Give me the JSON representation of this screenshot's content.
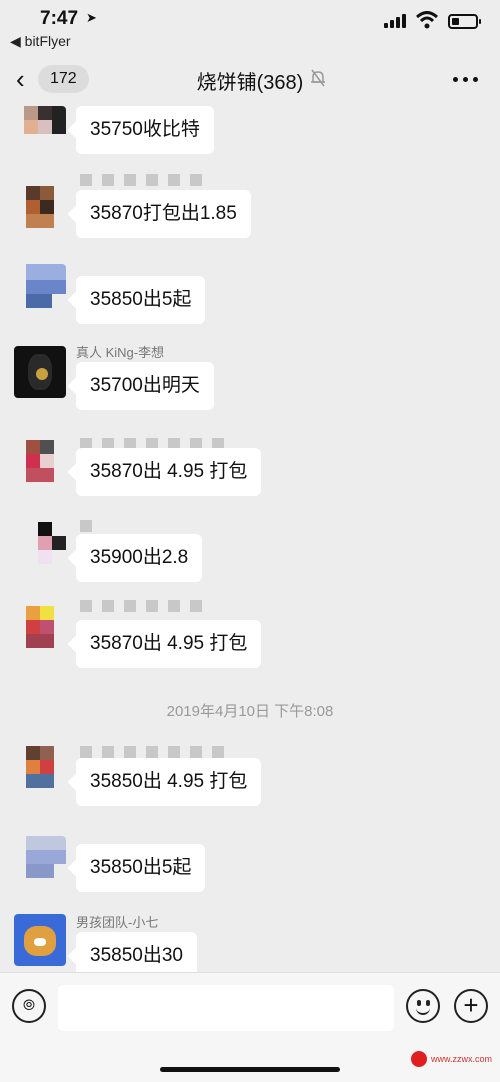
{
  "status_bar": {
    "time": "7:47",
    "back_app": "◀ bitFlyer"
  },
  "nav": {
    "unread_count": "172",
    "title": "烧饼铺(368)"
  },
  "messages": [
    {
      "sender": "",
      "text": "35750收比特"
    },
    {
      "sender": "",
      "text": "35870打包出1.85"
    },
    {
      "sender": "",
      "text": "35850出5起"
    },
    {
      "sender": "真人 KiNg-李想",
      "text": "35700出明天"
    },
    {
      "sender": "",
      "text": "35870出 4.95 打包"
    },
    {
      "sender": "",
      "text": "35900出2.8"
    },
    {
      "sender": "",
      "text": "35870出 4.95 打包"
    },
    {
      "sender": "",
      "text": "35850出 4.95 打包"
    },
    {
      "sender": "",
      "text": "35850出5起"
    },
    {
      "sender": "男孩团队-小七",
      "text": "35850出30"
    }
  ],
  "timestamp": "2019年4月10日 下午8:08",
  "input": {
    "placeholder": ""
  },
  "watermark": {
    "text": "www.zzwx.com"
  },
  "colors": {
    "background": "#ededed",
    "bubble": "#ffffff",
    "accent_red": "#e02020"
  },
  "icons": [
    "location-arrow-icon",
    "signal-icon",
    "wifi-icon",
    "battery-icon",
    "chevron-left-icon",
    "mute-bell-icon",
    "more-icon",
    "voice-icon",
    "emoji-icon",
    "plus-icon"
  ]
}
